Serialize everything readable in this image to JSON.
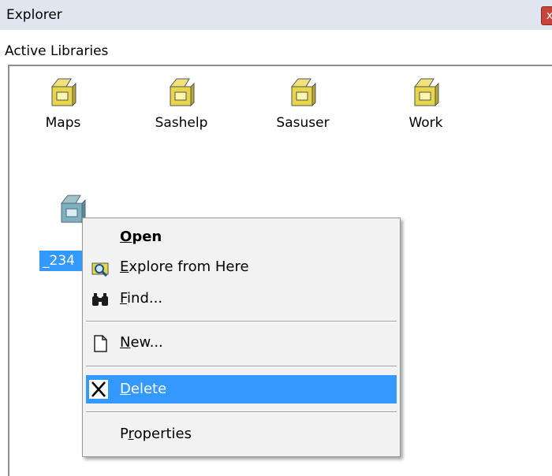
{
  "window": {
    "title": "Explorer",
    "close_label": "x"
  },
  "panel": {
    "header": "Active Libraries"
  },
  "libraries": [
    {
      "label": "Maps"
    },
    {
      "label": "Sashelp"
    },
    {
      "label": "Sasuser"
    },
    {
      "label": "Work"
    }
  ],
  "selected_library": {
    "label": "_234"
  },
  "context_menu": {
    "items": [
      {
        "label": "Open",
        "accel": "O",
        "rest": "pen",
        "bold": true
      },
      {
        "label": "Explore from Here",
        "accel": "E",
        "rest": "xplore from Here",
        "icon": "explore-icon"
      },
      {
        "label": "Find...",
        "accel": "F",
        "rest": "ind...",
        "icon": "binoculars-icon"
      },
      {
        "label": "New...",
        "accel": "N",
        "rest": "ew...",
        "icon": "new-document-icon"
      },
      {
        "label": "Delete",
        "accel": "D",
        "rest": "elete",
        "icon": "delete-x-icon",
        "highlighted": true
      },
      {
        "label": "Properties",
        "pre": "P",
        "accel": "r",
        "rest": "operties"
      }
    ]
  },
  "colors": {
    "highlight": "#3399ff",
    "titlebar": "#dfe6ef",
    "menu_bg": "#f2f2f2"
  }
}
